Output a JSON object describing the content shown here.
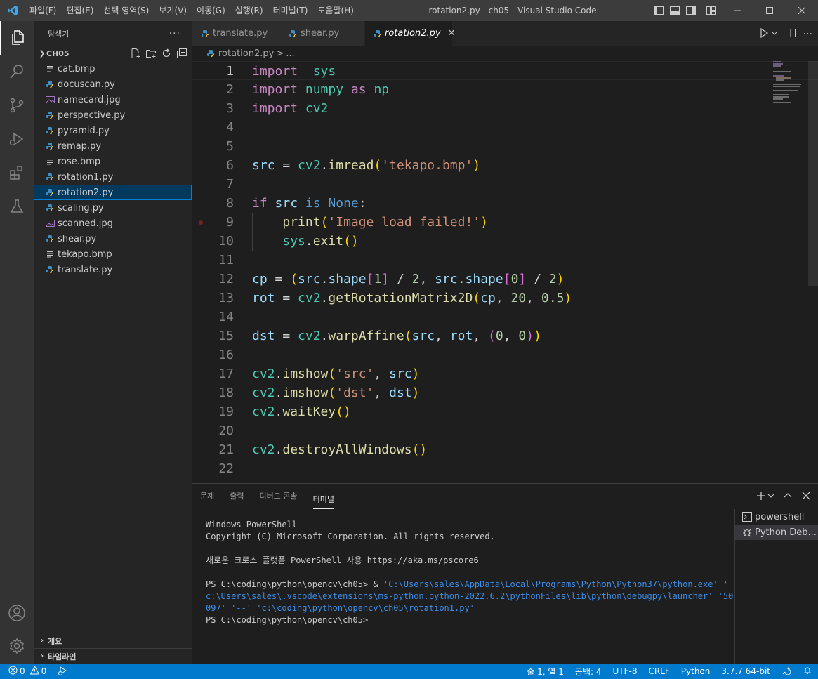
{
  "window": {
    "title": "rotation2.py - ch05 - Visual Studio Code",
    "menu": [
      "파일(F)",
      "편집(E)",
      "선택 영역(S)",
      "보기(V)",
      "이동(G)",
      "실행(R)",
      "터미널(T)",
      "도움말(H)"
    ]
  },
  "activity_bar": {
    "items": [
      "explorer-icon",
      "search-icon",
      "source-control-icon",
      "run-debug-icon",
      "extensions-icon",
      "testing-icon"
    ],
    "bottom": [
      "account-icon",
      "settings-gear-icon"
    ]
  },
  "explorer": {
    "header": "탐색기",
    "more": "···",
    "folder": "CH05",
    "files": [
      {
        "name": "cat.bmp",
        "type": "bmp"
      },
      {
        "name": "docuscan.py",
        "type": "py"
      },
      {
        "name": "namecard.jpg",
        "type": "jpg"
      },
      {
        "name": "perspective.py",
        "type": "py"
      },
      {
        "name": "pyramid.py",
        "type": "py"
      },
      {
        "name": "remap.py",
        "type": "py"
      },
      {
        "name": "rose.bmp",
        "type": "bmp"
      },
      {
        "name": "rotation1.py",
        "type": "py"
      },
      {
        "name": "rotation2.py",
        "type": "py",
        "selected": true
      },
      {
        "name": "scaling.py",
        "type": "py"
      },
      {
        "name": "scanned.jpg",
        "type": "jpg"
      },
      {
        "name": "shear.py",
        "type": "py"
      },
      {
        "name": "tekapo.bmp",
        "type": "bmp"
      },
      {
        "name": "translate.py",
        "type": "py"
      }
    ],
    "outline": "개요",
    "timeline": "타임라인"
  },
  "tabs": [
    {
      "label": "translate.py",
      "active": false
    },
    {
      "label": "shear.py",
      "active": false
    },
    {
      "label": "rotation2.py",
      "active": true,
      "close": "✕"
    }
  ],
  "breadcrumb": {
    "file": "rotation2.py",
    "sep": ">",
    "rest": "..."
  },
  "editor": {
    "active_line": 1,
    "breakpoint_line": 9,
    "lines": [
      {
        "n": "1",
        "tokens": [
          [
            "kw",
            "import"
          ],
          [
            "",
            "  "
          ],
          [
            "mod",
            "sys"
          ]
        ]
      },
      {
        "n": "2",
        "tokens": [
          [
            "kw",
            "import"
          ],
          [
            "",
            " "
          ],
          [
            "mod",
            "numpy"
          ],
          [
            "",
            " "
          ],
          [
            "kw",
            "as"
          ],
          [
            "",
            " "
          ],
          [
            "mod",
            "np"
          ]
        ]
      },
      {
        "n": "3",
        "tokens": [
          [
            "kw",
            "import"
          ],
          [
            "",
            " "
          ],
          [
            "mod",
            "cv2"
          ]
        ]
      },
      {
        "n": "4",
        "tokens": []
      },
      {
        "n": "5",
        "tokens": []
      },
      {
        "n": "6",
        "tokens": [
          [
            "var",
            "src"
          ],
          [
            "",
            " = "
          ],
          [
            "mod",
            "cv2"
          ],
          [
            "",
            "."
          ],
          [
            "fn",
            "imread"
          ],
          [
            "br1",
            "("
          ],
          [
            "str",
            "'tekapo.bmp'"
          ],
          [
            "br1",
            ")"
          ]
        ]
      },
      {
        "n": "7",
        "tokens": []
      },
      {
        "n": "8",
        "tokens": [
          [
            "kw",
            "if"
          ],
          [
            "",
            " "
          ],
          [
            "var",
            "src"
          ],
          [
            "",
            " "
          ],
          [
            "kb",
            "is"
          ],
          [
            "",
            " "
          ],
          [
            "kb",
            "None"
          ],
          [
            "",
            ":"
          ]
        ]
      },
      {
        "n": "9",
        "tokens": [
          [
            "",
            "    "
          ],
          [
            "fn",
            "print"
          ],
          [
            "br1",
            "("
          ],
          [
            "str",
            "'Image load failed!'"
          ],
          [
            "br1",
            ")"
          ]
        ]
      },
      {
        "n": "10",
        "tokens": [
          [
            "",
            "    "
          ],
          [
            "mod",
            "sys"
          ],
          [
            "",
            "."
          ],
          [
            "fn",
            "exit"
          ],
          [
            "br1",
            "()"
          ]
        ]
      },
      {
        "n": "11",
        "tokens": []
      },
      {
        "n": "12",
        "tokens": [
          [
            "var",
            "cp"
          ],
          [
            "",
            " = "
          ],
          [
            "br1",
            "("
          ],
          [
            "var",
            "src"
          ],
          [
            "",
            "."
          ],
          [
            "var",
            "shape"
          ],
          [
            "br2",
            "["
          ],
          [
            "num",
            "1"
          ],
          [
            "br2",
            "]"
          ],
          [
            "",
            " / "
          ],
          [
            "num",
            "2"
          ],
          [
            "",
            ", "
          ],
          [
            "var",
            "src"
          ],
          [
            "",
            "."
          ],
          [
            "var",
            "shape"
          ],
          [
            "br2",
            "["
          ],
          [
            "num",
            "0"
          ],
          [
            "br2",
            "]"
          ],
          [
            "",
            " / "
          ],
          [
            "num",
            "2"
          ],
          [
            "br1",
            ")"
          ]
        ]
      },
      {
        "n": "13",
        "tokens": [
          [
            "var",
            "rot"
          ],
          [
            "",
            " = "
          ],
          [
            "mod",
            "cv2"
          ],
          [
            "",
            "."
          ],
          [
            "fn",
            "getRotationMatrix2D"
          ],
          [
            "br1",
            "("
          ],
          [
            "var",
            "cp"
          ],
          [
            "",
            ", "
          ],
          [
            "num",
            "20"
          ],
          [
            "",
            ", "
          ],
          [
            "num",
            "0.5"
          ],
          [
            "br1",
            ")"
          ]
        ]
      },
      {
        "n": "14",
        "tokens": []
      },
      {
        "n": "15",
        "tokens": [
          [
            "var",
            "dst"
          ],
          [
            "",
            " = "
          ],
          [
            "mod",
            "cv2"
          ],
          [
            "",
            "."
          ],
          [
            "fn",
            "warpAffine"
          ],
          [
            "br1",
            "("
          ],
          [
            "var",
            "src"
          ],
          [
            "",
            ", "
          ],
          [
            "var",
            "rot"
          ],
          [
            "",
            ", "
          ],
          [
            "br2",
            "("
          ],
          [
            "num",
            "0"
          ],
          [
            "",
            ", "
          ],
          [
            "num",
            "0"
          ],
          [
            "br2",
            ")"
          ],
          [
            "br1",
            ")"
          ]
        ]
      },
      {
        "n": "16",
        "tokens": []
      },
      {
        "n": "17",
        "tokens": [
          [
            "mod",
            "cv2"
          ],
          [
            "",
            "."
          ],
          [
            "fn",
            "imshow"
          ],
          [
            "br1",
            "("
          ],
          [
            "str",
            "'src'"
          ],
          [
            "",
            ", "
          ],
          [
            "var",
            "src"
          ],
          [
            "br1",
            ")"
          ]
        ]
      },
      {
        "n": "18",
        "tokens": [
          [
            "mod",
            "cv2"
          ],
          [
            "",
            "."
          ],
          [
            "fn",
            "imshow"
          ],
          [
            "br1",
            "("
          ],
          [
            "str",
            "'dst'"
          ],
          [
            "",
            ", "
          ],
          [
            "var",
            "dst"
          ],
          [
            "br1",
            ")"
          ]
        ]
      },
      {
        "n": "19",
        "tokens": [
          [
            "mod",
            "cv2"
          ],
          [
            "",
            "."
          ],
          [
            "fn",
            "waitKey"
          ],
          [
            "br1",
            "()"
          ]
        ]
      },
      {
        "n": "20",
        "tokens": []
      },
      {
        "n": "21",
        "tokens": [
          [
            "mod",
            "cv2"
          ],
          [
            "",
            "."
          ],
          [
            "fn",
            "destroyAllWindows"
          ],
          [
            "br1",
            "()"
          ]
        ]
      },
      {
        "n": "22",
        "tokens": []
      }
    ]
  },
  "panel": {
    "tabs": [
      "문제",
      "출력",
      "디버그 콘솔",
      "터미널"
    ],
    "active_tab": "터미널",
    "terminal_lines": [
      "Windows PowerShell",
      "Copyright (C) Microsoft Corporation. All rights reserved.",
      "",
      "새로운 크로스 플랫폼 PowerShell 사용 https://aka.ms/pscore6",
      ""
    ],
    "prompt": "PS C:\\coding\\python\\opencv\\ch05>",
    "command_amp": " & ",
    "command": "'C:\\Users\\sales\\AppData\\Local\\Programs\\Python\\Python37\\python.exe' '\nc:\\Users\\sales\\.vscode\\extensions\\ms-python.python-2022.6.2\\pythonFiles\\lib\\python\\debugpy\\launcher' '50\n097' '--' 'c:\\coding\\python\\opencv\\ch05\\rotation1.py'",
    "final_prompt": "PS C:\\coding\\python\\opencv\\ch05>",
    "terminals": [
      {
        "label": "powershell",
        "icon": "terminal-icon",
        "active": false
      },
      {
        "label": "Python Deb...",
        "icon": "debug-bug-icon",
        "active": true
      }
    ]
  },
  "statusbar": {
    "errors": "0",
    "warnings": "0",
    "position": "줄 1, 열 1",
    "spaces": "공백: 4",
    "encoding": "UTF-8",
    "eol": "CRLF",
    "language": "Python",
    "interpreter": "3.7.7 64-bit"
  },
  "colors": {
    "accent": "#007acc",
    "titlebar": "#3c3c3c",
    "sidebar": "#252526",
    "editor": "#1e1e1e"
  }
}
